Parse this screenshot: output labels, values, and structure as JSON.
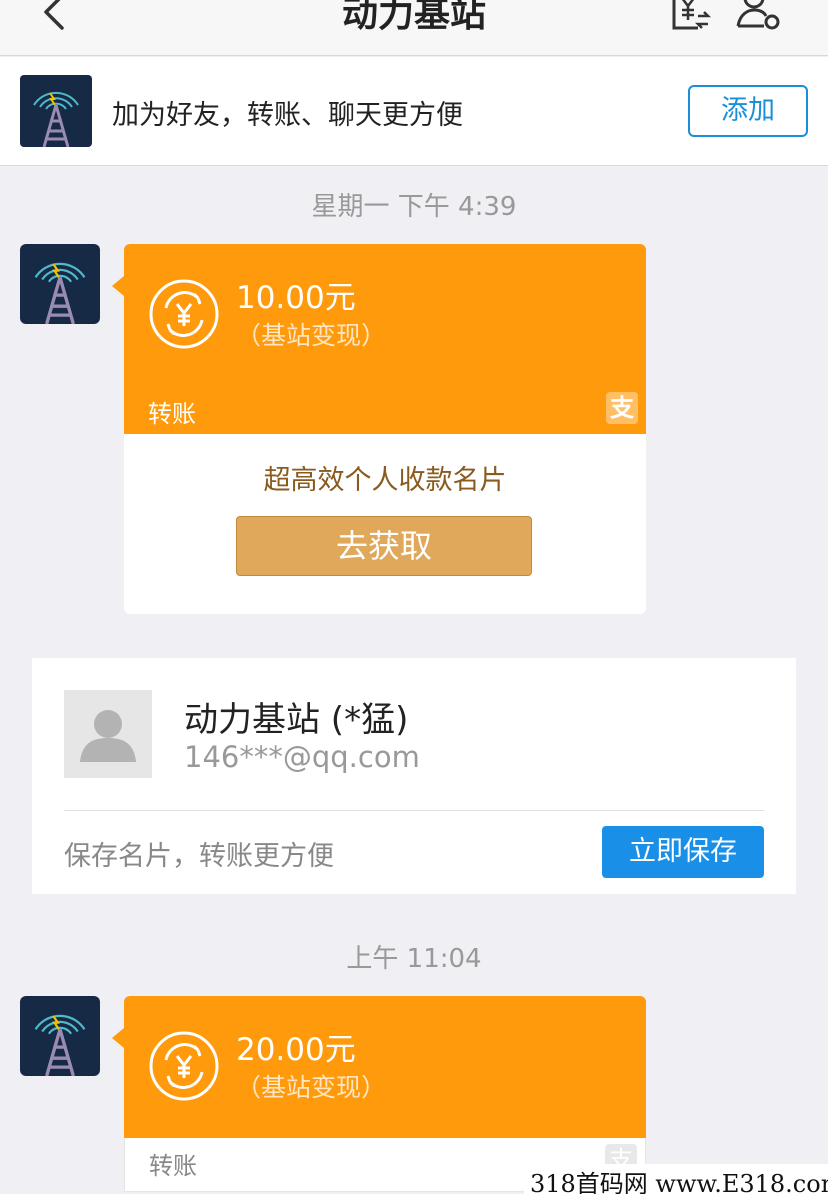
{
  "nav": {
    "title": "动力基站"
  },
  "friend_bar": {
    "text": "加为好友，转账、聊天更方便",
    "add_label": "添加"
  },
  "messages": [
    {
      "time": "星期一 下午 4:39",
      "amount": "10.00元",
      "memo": "（基站变现）",
      "kind": "转账",
      "promo": "超高效个人收款名片",
      "get_label": "去获取"
    },
    {
      "time": "上午 11:04",
      "amount": "20.00元",
      "memo": "（基站变现）",
      "kind": "转账"
    }
  ],
  "contact_card": {
    "name": "动力基站 (*猛)",
    "email": "146***@qq.com",
    "hint": "保存名片，转账更方便",
    "save_label": "立即保存"
  },
  "icons": {
    "alipay_badge": "支",
    "colors": {
      "orange": "#ff9a0c",
      "blue": "#1a8fe8",
      "gold": "#dfa85a"
    }
  },
  "watermark": "318首码网 www.E318.com"
}
